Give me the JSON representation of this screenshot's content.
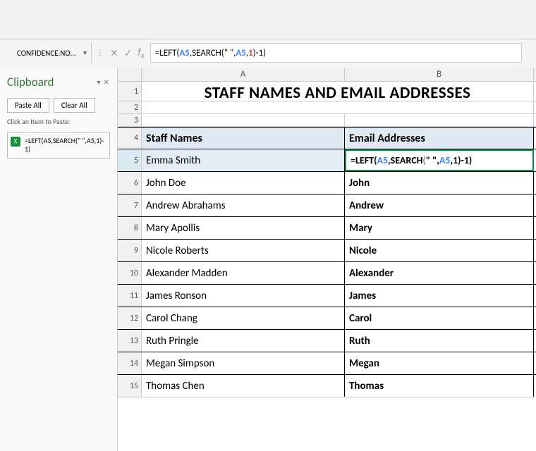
{
  "name_box": "CONFIDENCE.NO...",
  "formula_display_plain": "=LEFT(A5,SEARCH(\" \",A5,1)-1)",
  "clipboard": {
    "title": "Clipboard",
    "paste_all": "Paste All",
    "clear_all": "Clear All",
    "hint": "Click an Item to Paste:",
    "item_text": "=LEFT(A5,SEARCH(\" \",A5,1)-1)"
  },
  "columns": {
    "A": "A",
    "B": "B"
  },
  "title_row": "STAFF NAMES AND EMAIL ADDRESSES",
  "headers": {
    "A": "Staff Names",
    "B": "Email Addresses"
  },
  "selected_cell_formula": "=LEFT(A5,SEARCH(\" \",A5,1)-1)",
  "rows": [
    {
      "n": 5,
      "a": "Emma Smith",
      "b_is_formula": true
    },
    {
      "n": 6,
      "a": "John Doe",
      "b": "John"
    },
    {
      "n": 7,
      "a": "Andrew Abrahams",
      "b": "Andrew"
    },
    {
      "n": 8,
      "a": "Mary Apollis",
      "b": "Mary"
    },
    {
      "n": 9,
      "a": "Nicole Roberts",
      "b": "Nicole"
    },
    {
      "n": 10,
      "a": "Alexander Madden",
      "b": "Alexander"
    },
    {
      "n": 11,
      "a": "James Ronson",
      "b": "James"
    },
    {
      "n": 12,
      "a": "Carol Chang",
      "b": "Carol"
    },
    {
      "n": 13,
      "a": "Ruth Pringle",
      "b": "Ruth"
    },
    {
      "n": 14,
      "a": "Megan Simpson",
      "b": "Megan"
    },
    {
      "n": 15,
      "a": "Thomas Chen",
      "b": "Thomas"
    }
  ],
  "chart_data": {
    "type": "table",
    "title": "STAFF NAMES AND EMAIL ADDRESSES",
    "columns": [
      "Staff Names",
      "Email Addresses"
    ],
    "rows": [
      [
        "Emma Smith",
        "=LEFT(A5,SEARCH(\" \",A5,1)-1)"
      ],
      [
        "John Doe",
        "John"
      ],
      [
        "Andrew Abrahams",
        "Andrew"
      ],
      [
        "Mary Apollis",
        "Mary"
      ],
      [
        "Nicole Roberts",
        "Nicole"
      ],
      [
        "Alexander Madden",
        "Alexander"
      ],
      [
        "James Ronson",
        "James"
      ],
      [
        "Carol Chang",
        "Carol"
      ],
      [
        "Ruth Pringle",
        "Ruth"
      ],
      [
        "Megan Simpson",
        "Megan"
      ],
      [
        "Thomas Chen",
        "Thomas"
      ]
    ]
  }
}
